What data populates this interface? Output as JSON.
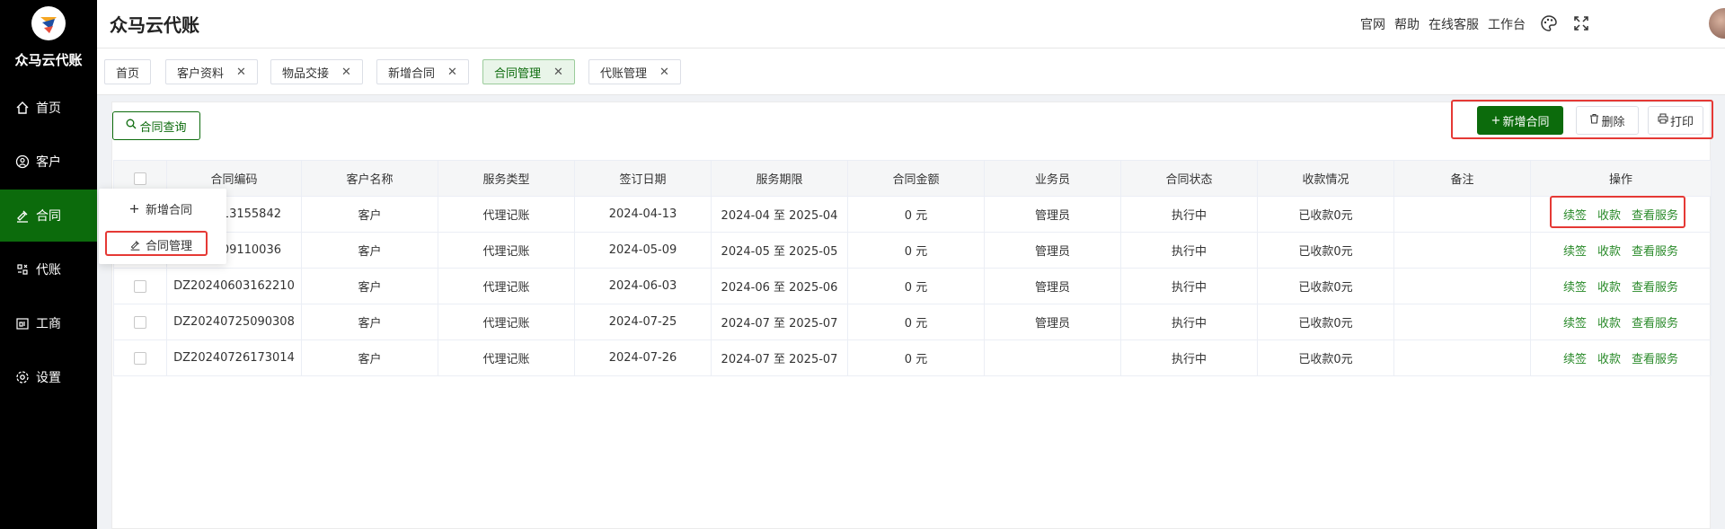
{
  "sidebar": {
    "logo_text": "众马云代账",
    "items": [
      {
        "label": "首页",
        "icon": "home-icon"
      },
      {
        "label": "客户",
        "icon": "user-icon"
      },
      {
        "label": "合同",
        "icon": "contract-icon"
      },
      {
        "label": "代账",
        "icon": "accounting-icon"
      },
      {
        "label": "工商",
        "icon": "business-icon"
      },
      {
        "label": "设置",
        "icon": "gear-icon"
      }
    ]
  },
  "header": {
    "brand": "众马云代账",
    "links": [
      "官网",
      "帮助",
      "在线客服",
      "工作台"
    ]
  },
  "tabs": [
    {
      "label": "首页",
      "closable": false
    },
    {
      "label": "客户资料",
      "closable": true
    },
    {
      "label": "物品交接",
      "closable": true
    },
    {
      "label": "新增合同",
      "closable": true
    },
    {
      "label": "合同管理",
      "closable": true,
      "active": true
    },
    {
      "label": "代账管理",
      "closable": true
    }
  ],
  "toolbar": {
    "query_label": "合同查询",
    "add_label": "新增合同",
    "delete_label": "删除",
    "print_label": "打印"
  },
  "submenu": {
    "items": [
      "新增合同",
      "合同管理"
    ]
  },
  "table": {
    "columns": [
      "合同编码",
      "客户名称",
      "服务类型",
      "签订日期",
      "服务期限",
      "合同金额",
      "业务员",
      "合同状态",
      "收款情况",
      "备注",
      "操作"
    ],
    "rows": [
      {
        "code": "DZ20240413155842",
        "code_visible": "0413155842",
        "customer": "客户",
        "type": "代理记账",
        "date": "2024-04-13",
        "period": "2024-04 至 2025-04",
        "amount": "0 元",
        "salesman": "管理员",
        "status": "执行中",
        "payment": "已收款0元",
        "note": ""
      },
      {
        "code": "DZ20240509110036",
        "code_visible": "0509110036",
        "customer": "客户",
        "type": "代理记账",
        "date": "2024-05-09",
        "period": "2024-05 至 2025-05",
        "amount": "0 元",
        "salesman": "管理员",
        "status": "执行中",
        "payment": "已收款0元",
        "note": ""
      },
      {
        "code": "DZ20240603162210",
        "customer": "客户",
        "type": "代理记账",
        "date": "2024-06-03",
        "period": "2024-06 至 2025-06",
        "amount": "0 元",
        "salesman": "管理员",
        "status": "执行中",
        "payment": "已收款0元",
        "note": ""
      },
      {
        "code": "DZ20240725090308",
        "customer": "客户",
        "type": "代理记账",
        "date": "2024-07-25",
        "period": "2024-07 至 2025-07",
        "amount": "0 元",
        "salesman": "管理员",
        "status": "执行中",
        "payment": "已收款0元",
        "note": ""
      },
      {
        "code": "DZ20240726173014",
        "customer": "客户",
        "type": "代理记账",
        "date": "2024-07-26",
        "period": "2024-07 至 2025-07",
        "amount": "0 元",
        "salesman": "",
        "status": "执行中",
        "payment": "已收款0元",
        "note": ""
      }
    ],
    "row_actions": [
      "续签",
      "收款",
      "查看服务"
    ]
  },
  "colors": {
    "accent": "#0c6b0c",
    "link_green": "#2a8a2a",
    "payment_red": "#f56c6c",
    "highlight_red": "#e53935"
  }
}
